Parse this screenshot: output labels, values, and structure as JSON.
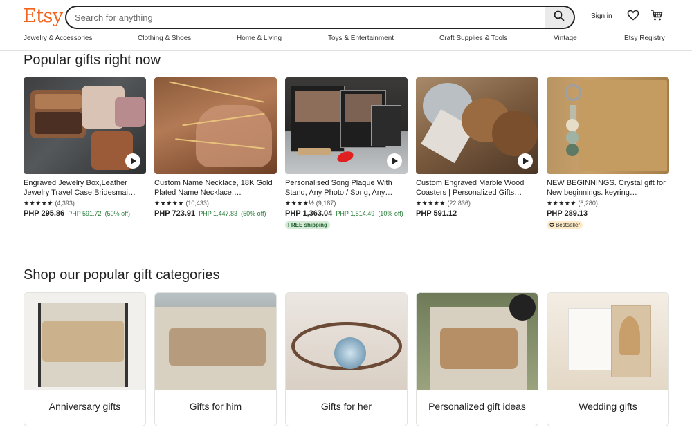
{
  "header": {
    "logo": "Etsy",
    "search_placeholder": "Search for anything",
    "sign_in": "Sign in",
    "icons": [
      "search-icon",
      "heart-icon",
      "cart-icon"
    ]
  },
  "nav": [
    "Jewelry & Accessories",
    "Clothing & Shoes",
    "Home & Living",
    "Toys & Entertainment",
    "Craft Supplies & Tools",
    "Vintage",
    "Etsy Registry"
  ],
  "sections": {
    "popular_title": "Popular gifts right now",
    "categories_title": "Shop our popular gift categories"
  },
  "products": [
    {
      "title": "Engraved Jewelry Box,Leather Jewelry Travel Case,Bridesmai…",
      "stars": "★★★★★",
      "reviews": "(4,393)",
      "price": "PHP 295.86",
      "original": "PHP 591.72",
      "discount": "(50% off)",
      "video": true
    },
    {
      "title": "Custom Name Necklace, 18K Gold Plated Name Necklace,…",
      "stars": "★★★★★",
      "reviews": "(10,433)",
      "price": "PHP 723.91",
      "original": "PHP 1,447.83",
      "discount": "(50% off)",
      "video": false
    },
    {
      "title": "Personalised Song Plaque With Stand, Any Photo / Song, Any…",
      "stars": "★★★★½",
      "reviews": "(9,187)",
      "price": "PHP 1,363.04",
      "original": "PHP 1,514.49",
      "discount": "(10% off)",
      "badge": "FREE shipping",
      "video": true
    },
    {
      "title": "Custom Engraved Marble Wood Coasters | Personalized Gifts…",
      "stars": "★★★★★",
      "reviews": "(22,836)",
      "price": "PHP 591.12",
      "video": true
    },
    {
      "title": "NEW BEGINNINGS. Crystal gift for New beginnings. keyring…",
      "stars": "★★★★★",
      "reviews": "(6,280)",
      "price": "PHP 289.13",
      "badge": "Bestseller",
      "video": false
    }
  ],
  "categories": [
    {
      "label": "Anniversary gifts"
    },
    {
      "label": "Gifts for him"
    },
    {
      "label": "Gifts for her"
    },
    {
      "label": "Personalized gift ideas"
    },
    {
      "label": "Wedding gifts"
    }
  ],
  "colors": {
    "brand": "#f1641e",
    "sale": "#2a7d3b",
    "free_shipping_bg": "#d4e9d6",
    "bestseller_bg": "#fdebc8"
  }
}
